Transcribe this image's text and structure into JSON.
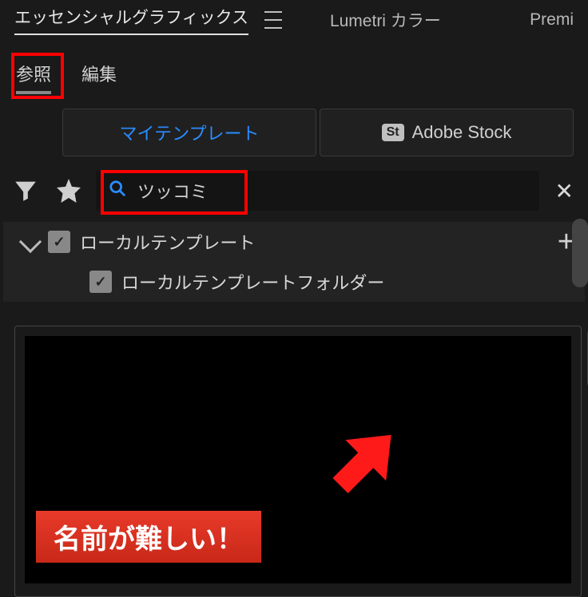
{
  "tabs": {
    "essential_graphics": "エッセンシャルグラフィックス",
    "lumetri_color": "Lumetri カラー",
    "premiere": "Premi"
  },
  "subtabs": {
    "browse": "参照",
    "edit": "編集"
  },
  "sources": {
    "my_templates": "マイテンプレート",
    "adobe_stock": "Adobe Stock",
    "stock_badge": "St"
  },
  "search": {
    "value": "ツッコミ"
  },
  "tree": {
    "local_templates": "ローカルテンプレート",
    "local_templates_folder": "ローカルテンプレートフォルダー"
  },
  "preview": {
    "telop_text": "名前が難しい！"
  }
}
